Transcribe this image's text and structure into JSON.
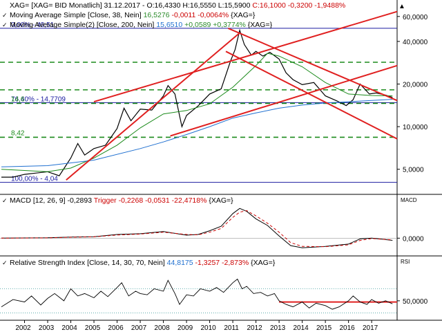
{
  "chart_data": [
    {
      "type": "line",
      "panel": "price",
      "header": [
        {
          "text": "XAG= [XAG= BID Monatlich] 31.12.2017 - O:16,4330 H:16,5550 L:15,5900 C:16,1000 -0,3200 -1,9488%",
          "segments": [
            {
              "text": "XAG= [XAG= BID Monatlich] 31.12.2017 - O:16,4330 H:16,5550 L:15,5900 ",
              "color": "#000000"
            },
            {
              "text": "C:16,1000 -0,3200 -1,9488%",
              "color": "#cc0000"
            }
          ]
        },
        {
          "segments": [
            {
              "text": "Moving Average Simple [Close, 38, Nein] ",
              "color": "#000000"
            },
            {
              "text": "16,5276 ",
              "color": "#2a8a2a"
            },
            {
              "text": "-0,0011 -0,0064% ",
              "color": "#cc0000"
            },
            {
              "text": "{XAG=}",
              "color": "#000000"
            }
          ]
        },
        {
          "segments": [
            {
              "text": "Moving Average Simple(2) [Close, 200, Nein] ",
              "color": "#000000"
            },
            {
              "text": "15,6510 ",
              "color": "#1e6fd0"
            },
            {
              "text": "+0,0589 +0,3774% ",
              "color": "#2a8a2a"
            },
            {
              "text": "{XAG=}",
              "color": "#000000"
            }
          ]
        }
      ],
      "ylabels": [
        "60,0000",
        "40,0000",
        "20,0000",
        "10,0000",
        "5,0000"
      ],
      "yticks": [
        60,
        40,
        20,
        10,
        5
      ],
      "ylim": [
        3.4,
        75
      ],
      "log_scale": true,
      "fib_levels": [
        {
          "label": "0,00% - 49,51",
          "value": 49.51,
          "color": "#1a1aa0"
        },
        {
          "label": "76,40% - 14,7709",
          "value": 14.7709,
          "color": "#1a1aa0"
        },
        {
          "label": "100,00% - 4,04",
          "value": 4.04,
          "color": "#1a1aa0"
        }
      ],
      "support_levels": [
        {
          "label": "14,6",
          "value": 14.6,
          "color": "#1a8a1a"
        },
        {
          "label": "8,42",
          "value": 8.42,
          "color": "#1a8a1a"
        },
        {
          "label": "",
          "value": 28.5,
          "color": "#1a8a1a"
        },
        {
          "label": "",
          "value": 18.2,
          "color": "#1a8a1a"
        }
      ],
      "trend_lines": [
        {
          "x1": 2003.8,
          "y1": 4.2,
          "x2": 2011.3,
          "y2": 46
        },
        {
          "x1": 2005.0,
          "y1": 15.0,
          "x2": 2018.1,
          "y2": 65
        },
        {
          "x1": 2008.3,
          "y1": 8.6,
          "x2": 2018.1,
          "y2": 27
        },
        {
          "x1": 2010.8,
          "y1": 49.5,
          "x2": 2018.1,
          "y2": 15.3
        },
        {
          "x1": 2010.7,
          "y1": 34,
          "x2": 2018.1,
          "y2": 8.2
        }
      ],
      "series": [
        {
          "name": "XAG= [XAG= BID Monatlich]",
          "color": "#000000",
          "x": [
            2001.0,
            2001.5,
            2002.0,
            2002.5,
            2003.0,
            2003.5,
            2004.0,
            2004.3,
            2004.6,
            2005.0,
            2005.5,
            2006.0,
            2006.3,
            2006.6,
            2007.0,
            2007.5,
            2008.0,
            2008.2,
            2008.5,
            2008.8,
            2009.0,
            2009.5,
            2010.0,
            2010.5,
            2010.9,
            2011.1,
            2011.3,
            2011.5,
            2011.8,
            2012.0,
            2012.3,
            2012.6,
            2013.0,
            2013.3,
            2013.6,
            2014.0,
            2014.5,
            2015.0,
            2015.5,
            2015.9,
            2016.2,
            2016.5,
            2016.9,
            2017.2,
            2017.6,
            2017.9
          ],
          "values": [
            4.4,
            4.4,
            4.6,
            4.7,
            4.8,
            4.5,
            6.0,
            7.6,
            6.3,
            7.0,
            7.4,
            9.7,
            13.5,
            11.0,
            13.3,
            13.1,
            16.5,
            19.5,
            17.0,
            10.0,
            12.0,
            14.0,
            17.0,
            18.5,
            29.0,
            35.0,
            48.0,
            38.0,
            32.0,
            34.0,
            31.5,
            33.5,
            30.0,
            24.0,
            21.5,
            19.8,
            20.5,
            16.5,
            15.2,
            14.1,
            15.5,
            20.0,
            17.0,
            17.3,
            16.7,
            16.1
          ]
        },
        {
          "name": "Moving Average Simple [Close, 38, Nein]",
          "color": "#1a8a1a",
          "x": [
            2001.0,
            2003.0,
            2004.0,
            2005.0,
            2006.0,
            2007.0,
            2008.0,
            2009.0,
            2010.0,
            2011.0,
            2012.0,
            2012.5,
            2013.0,
            2014.0,
            2015.0,
            2016.0,
            2017.0,
            2017.9
          ],
          "values": [
            5.0,
            4.8,
            5.1,
            6.0,
            7.4,
            9.8,
            12.3,
            13.0,
            14.5,
            19.0,
            27.0,
            33.0,
            31.5,
            26.5,
            20.5,
            17.0,
            16.6,
            16.5
          ]
        },
        {
          "name": "Moving Average Simple(2) [Close, 200, Nein]",
          "color": "#1e6fd0",
          "x": [
            2001.0,
            2003.0,
            2005.0,
            2007.0,
            2008.0,
            2009.0,
            2010.0,
            2011.0,
            2012.0,
            2013.0,
            2014.0,
            2015.0,
            2016.0,
            2017.0,
            2017.9
          ],
          "values": [
            5.2,
            5.3,
            5.8,
            7.0,
            7.8,
            8.8,
            10.0,
            11.5,
            12.5,
            13.5,
            14.2,
            14.7,
            15.0,
            15.3,
            15.6
          ]
        }
      ]
    },
    {
      "type": "line",
      "panel": "macd",
      "header_segments": [
        {
          "text": "MACD [12, 26, 9] -0,2893 ",
          "color": "#000000"
        },
        {
          "text": "Trigger -0,2268 -0,0531 -22,4718% ",
          "color": "#cc0000"
        },
        {
          "text": "{XAG=}",
          "color": "#000000"
        }
      ],
      "corner_label": "MACD",
      "ylabels": [
        "0,0000"
      ],
      "yticks": [
        0
      ],
      "ylim": [
        -2.2,
        4.4
      ],
      "series": [
        {
          "name": "MACD",
          "color": "#000000",
          "x": [
            2001.0,
            2003.0,
            2004.0,
            2005.0,
            2006.0,
            2007.0,
            2008.0,
            2009.0,
            2009.5,
            2010.0,
            2010.5,
            2011.0,
            2011.3,
            2011.6,
            2012.0,
            2012.5,
            2013.0,
            2013.5,
            2014.0,
            2015.0,
            2016.0,
            2016.5,
            2017.0,
            2017.9
          ],
          "values": [
            0,
            0.05,
            0.15,
            0.2,
            0.5,
            0.6,
            0.9,
            0.4,
            0.5,
            1.0,
            1.6,
            3.3,
            4.0,
            3.6,
            2.6,
            1.7,
            0.3,
            -1.0,
            -1.3,
            -1.1,
            -0.8,
            -0.1,
            0.0,
            -0.29
          ]
        },
        {
          "name": "Trigger",
          "color": "#cc0000",
          "dash": "4,3",
          "x": [
            2001.0,
            2003.0,
            2004.0,
            2005.0,
            2006.0,
            2007.0,
            2008.0,
            2009.0,
            2009.5,
            2010.0,
            2010.5,
            2011.0,
            2011.3,
            2011.6,
            2012.0,
            2012.5,
            2013.0,
            2013.5,
            2014.0,
            2015.0,
            2016.0,
            2016.5,
            2017.0,
            2017.9
          ],
          "values": [
            0,
            0.04,
            0.12,
            0.18,
            0.42,
            0.55,
            0.8,
            0.5,
            0.45,
            0.8,
            1.3,
            2.8,
            3.5,
            3.7,
            3.0,
            2.0,
            0.8,
            -0.6,
            -1.1,
            -1.15,
            -0.9,
            -0.3,
            -0.05,
            -0.23
          ]
        }
      ]
    },
    {
      "type": "line",
      "panel": "rsi",
      "header_segments": [
        {
          "text": "Relative Strength Index [Close, 14, 30, 70, Nein] ",
          "color": "#000000"
        },
        {
          "text": "44,8175 ",
          "color": "#1e6fd0"
        },
        {
          "text": "-1,3257 -2,873% ",
          "color": "#cc0000"
        },
        {
          "text": "{XAG=}",
          "color": "#000000"
        }
      ],
      "corner_label": "RSI",
      "ylabels": [
        "50,0000"
      ],
      "yticks": [
        50
      ],
      "ylim": [
        20,
        105
      ],
      "bands": [
        70,
        30
      ],
      "support_value": 48.0,
      "series": [
        {
          "name": "Relative Strength Index",
          "color": "#000000",
          "x": [
            2001.0,
            2001.5,
            2002.0,
            2002.3,
            2002.7,
            2003.0,
            2003.3,
            2003.7,
            2004.0,
            2004.3,
            2004.6,
            2005.0,
            2005.3,
            2005.6,
            2006.0,
            2006.2,
            2006.5,
            2006.8,
            2007.0,
            2007.3,
            2007.6,
            2008.0,
            2008.2,
            2008.5,
            2008.7,
            2009.0,
            2009.3,
            2009.6,
            2010.0,
            2010.3,
            2010.6,
            2011.0,
            2011.2,
            2011.4,
            2011.6,
            2011.9,
            2012.2,
            2012.5,
            2012.8,
            2013.0,
            2013.3,
            2013.6,
            2014.0,
            2014.3,
            2014.6,
            2015.0,
            2015.3,
            2015.6,
            2016.0,
            2016.2,
            2016.5,
            2016.8,
            2017.0,
            2017.3,
            2017.6,
            2017.9
          ],
          "values": [
            40,
            52,
            48,
            58,
            43,
            54,
            62,
            50,
            70,
            58,
            62,
            55,
            66,
            57,
            72,
            80,
            58,
            66,
            62,
            60,
            70,
            66,
            84,
            62,
            44,
            60,
            58,
            70,
            66,
            72,
            64,
            80,
            86,
            70,
            74,
            62,
            64,
            58,
            62,
            50,
            44,
            40,
            48,
            38,
            46,
            42,
            36,
            40,
            50,
            58,
            48,
            44,
            52,
            46,
            50,
            45
          ]
        }
      ]
    }
  ],
  "xaxis": {
    "tick_labels": [
      "2002",
      "2003",
      "2004",
      "2005",
      "2006",
      "2007",
      "2008",
      "2009",
      "2010",
      "2011",
      "2012",
      "2013",
      "2014",
      "2015",
      "2016",
      "2017"
    ],
    "tick_values": [
      2002,
      2003,
      2004,
      2005,
      2006,
      2007,
      2008,
      2009,
      2010,
      2011,
      2012,
      2013,
      2014,
      2015,
      2016,
      2017
    ],
    "xlim": [
      2001.0,
      2018.1
    ]
  },
  "colors": {
    "price_line": "#000000",
    "trend": "#e02020",
    "support": "#1a8a1a",
    "fib": "#1a1aa0",
    "ma38": "#1a8a1a",
    "ma200": "#1e6fd0",
    "rsi_band": "#3a9a9a",
    "background": "#ffffff",
    "panel_border": "#000000"
  },
  "icons": {
    "collapse": "chevron-up-icon",
    "series_toggle": "check-icon"
  }
}
